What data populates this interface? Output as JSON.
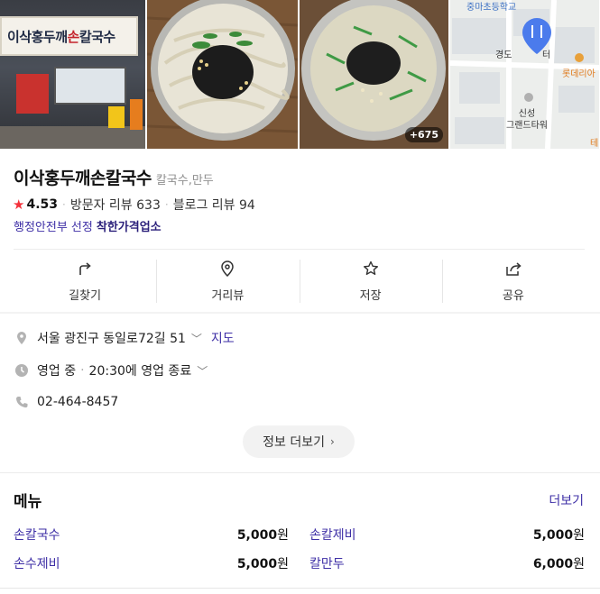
{
  "photos": {
    "store_sign": "이삭홍두깨손칼국수",
    "more_count": "+675",
    "map_labels": {
      "school": "중마초등학교",
      "poi_partial": "경도",
      "poi_partial_2": "터",
      "lotteria": "롯데리아",
      "building": "신성\n그랜드타워",
      "edge_right": "테"
    }
  },
  "place": {
    "name": "이삭홍두깨손칼국수",
    "category": "칼국수,만두",
    "rating": "4.53",
    "visitor_reviews": "방문자 리뷰 633",
    "blog_reviews": "블로그 리뷰 94",
    "badge_prefix": "행정안전부 선정",
    "badge_name": "착한가격업소"
  },
  "actions": [
    {
      "label": "길찾기",
      "icon": "directions-icon"
    },
    {
      "label": "거리뷰",
      "icon": "location-pin-icon"
    },
    {
      "label": "저장",
      "icon": "star-outline-icon"
    },
    {
      "label": "공유",
      "icon": "share-icon"
    }
  ],
  "info": {
    "address": "서울 광진구 동일로72길 51",
    "map_link": "지도",
    "status": "영업 중",
    "hours": "20:30에 영업 종료",
    "phone": "02-464-8457",
    "more_info": "정보 더보기"
  },
  "menu": {
    "title": "메뉴",
    "more": "더보기",
    "items": [
      {
        "name": "손칼국수",
        "price": "5,000",
        "unit": "원"
      },
      {
        "name": "손칼제비",
        "price": "5,000",
        "unit": "원"
      },
      {
        "name": "손수제비",
        "price": "5,000",
        "unit": "원"
      },
      {
        "name": "칼만두",
        "price": "6,000",
        "unit": "원"
      }
    ]
  },
  "colors": {
    "accent": "#3e2fa6",
    "star": "#f4313b",
    "map_pin": "#4b7bec"
  }
}
